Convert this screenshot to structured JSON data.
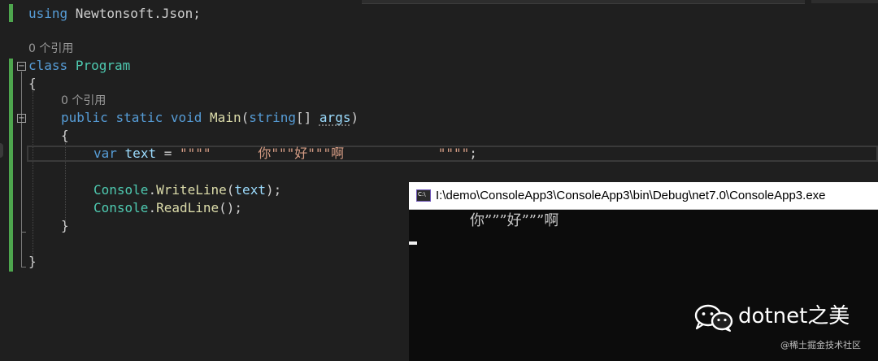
{
  "editor": {
    "using_kw": "using",
    "using_ns": " Newtonsoft.Json;",
    "ref_class": "0 个引用",
    "class_kw": "class",
    "class_name": "Program",
    "brace_open": "{",
    "ref_main": "0 个引用",
    "main_public": "public",
    "main_static": "static",
    "main_void": "void",
    "main_name": "Main",
    "main_paren_open": "(",
    "main_string": "string",
    "main_brackets": "[] ",
    "main_args": "args",
    "main_paren_close": ")",
    "inner_brace_open": "{",
    "var_kw": "var",
    "var_name": "text",
    "assign": " = ",
    "string_literal": "\"\"\"\"      你\"\"\"好\"\"\"啊            \"\"\"\"",
    "semicolon": ";",
    "console_cls1": "Console",
    "dot1": ".",
    "writeline": "WriteLine",
    "writeline_args_open": "(",
    "writeline_arg": "text",
    "writeline_args_close": ");",
    "console_cls2": "Console",
    "dot2": ".",
    "readline": "ReadLine",
    "readline_args": "();",
    "inner_brace_close": "}",
    "brace_close": "}"
  },
  "console": {
    "icon_label": "C:\\",
    "title": "I:\\demo\\ConsoleApp3\\ConsoleApp3\\bin\\Debug\\net7.0\\ConsoleApp3.exe",
    "output": "你”””好”””啊"
  },
  "watermark": {
    "brand": "dotnet之美",
    "sub": "@稀土掘金技术社区"
  },
  "colors": {
    "keyword": "#569cd6",
    "class": "#4ec9b0",
    "method": "#dcdcaa",
    "variable": "#9cdcfe",
    "string": "#d69d85",
    "gutter_change": "#4ea64e"
  }
}
